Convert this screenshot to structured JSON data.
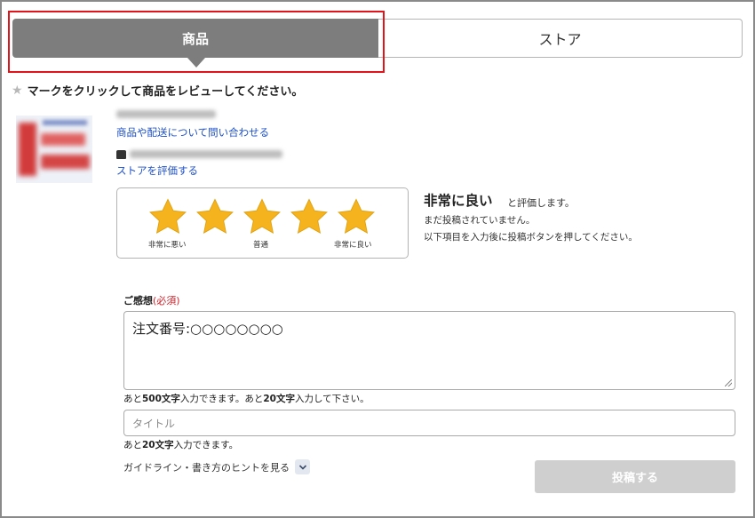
{
  "tabs": [
    {
      "label": "商品",
      "active": true
    },
    {
      "label": "ストア",
      "active": false
    }
  ],
  "instruction": "マークをクリックして商品をレビューしてください。",
  "product": {
    "inquiry_link": "商品や配送について問い合わせる",
    "store_review_link": "ストアを評価する"
  },
  "rating": {
    "value": 5,
    "max": 5,
    "scale_low": "非常に悪い",
    "scale_mid": "普通",
    "scale_high": "非常に良い",
    "star_color": "#f5b41e"
  },
  "evaluation": {
    "title": "非常に良い",
    "suffix": "と評価します。",
    "note1": "まだ投稿されていません。",
    "note2": "以下項目を入力後に投稿ボタンを押してください。"
  },
  "comment": {
    "label": "ご感想",
    "required": "(必須)",
    "value": "注文番号:○○○○○○○○",
    "hint_pre1": "あと",
    "hint_num1": "500文字",
    "hint_mid1": "入力できます。あと",
    "hint_num2": "20文字",
    "hint_post1": "入力して下さい。"
  },
  "title_field": {
    "placeholder": "タイトル",
    "hint_pre": "あと",
    "hint_num": "20文字",
    "hint_post": "入力できます。"
  },
  "guide_link": "ガイドライン・書き方のヒントを見る",
  "submit_label": "投稿する",
  "colors": {
    "tab_active": "#7d7d7d",
    "highlight_box": "#e0141a",
    "link": "#1e50c8",
    "required": "#d0222a",
    "submit_disabled": "#cfcfcf"
  }
}
